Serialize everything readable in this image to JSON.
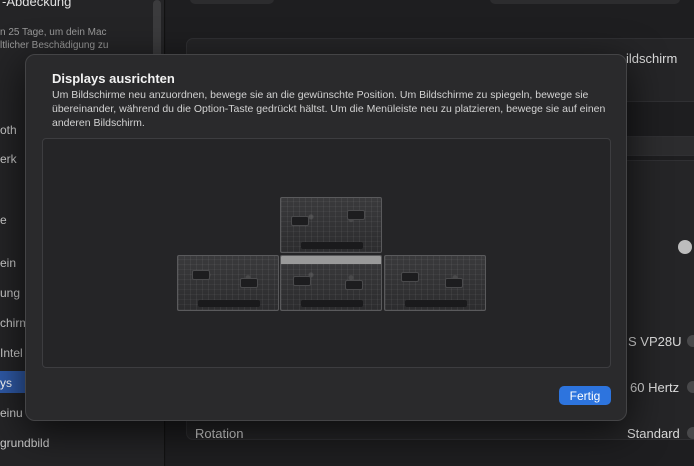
{
  "sidebar": {
    "header_title": "-Abdeckung",
    "notice_lines": [
      "n 25 Tage, um dein Mac",
      "ltlicher Beschädigung zu"
    ],
    "items": [
      {
        "label": "oth"
      },
      {
        "label": "erk"
      },
      {
        "label": "e"
      },
      {
        "label": "ein"
      },
      {
        "label": "ung"
      },
      {
        "label": "chirm"
      },
      {
        "label": "Intel"
      },
      {
        "label": "ys",
        "selected": true
      },
      {
        "label": "einu"
      },
      {
        "label": "grundbild"
      }
    ]
  },
  "settings_rows": {
    "displays_label": "ildschirm",
    "display_model": "S VP28U",
    "refresh_rate": "60 Hertz",
    "rotation_label": "Rotation",
    "rotation_value": "Standard"
  },
  "dialog": {
    "title": "Displays ausrichten",
    "description": "Um Bildschirme neu anzuordnen, bewege sie an die gewünschte Position. Um Bildschirme zu spiegeln, bewege sie übereinander, während du die Option-Taste gedrückt hältst. Um die Menüleiste neu zu platzieren, bewege sie auf einen anderen Bildschirm.",
    "done_label": "Fertig",
    "displays": [
      {
        "id": "display-left",
        "has_menubar": false
      },
      {
        "id": "display-top",
        "has_menubar": false
      },
      {
        "id": "display-center",
        "has_menubar": true
      },
      {
        "id": "display-right",
        "has_menubar": false
      }
    ]
  },
  "colors": {
    "accent": "#2d74de",
    "sidebar_selection": "#2f5aa8",
    "sheet_background": "#2a2a2c"
  }
}
